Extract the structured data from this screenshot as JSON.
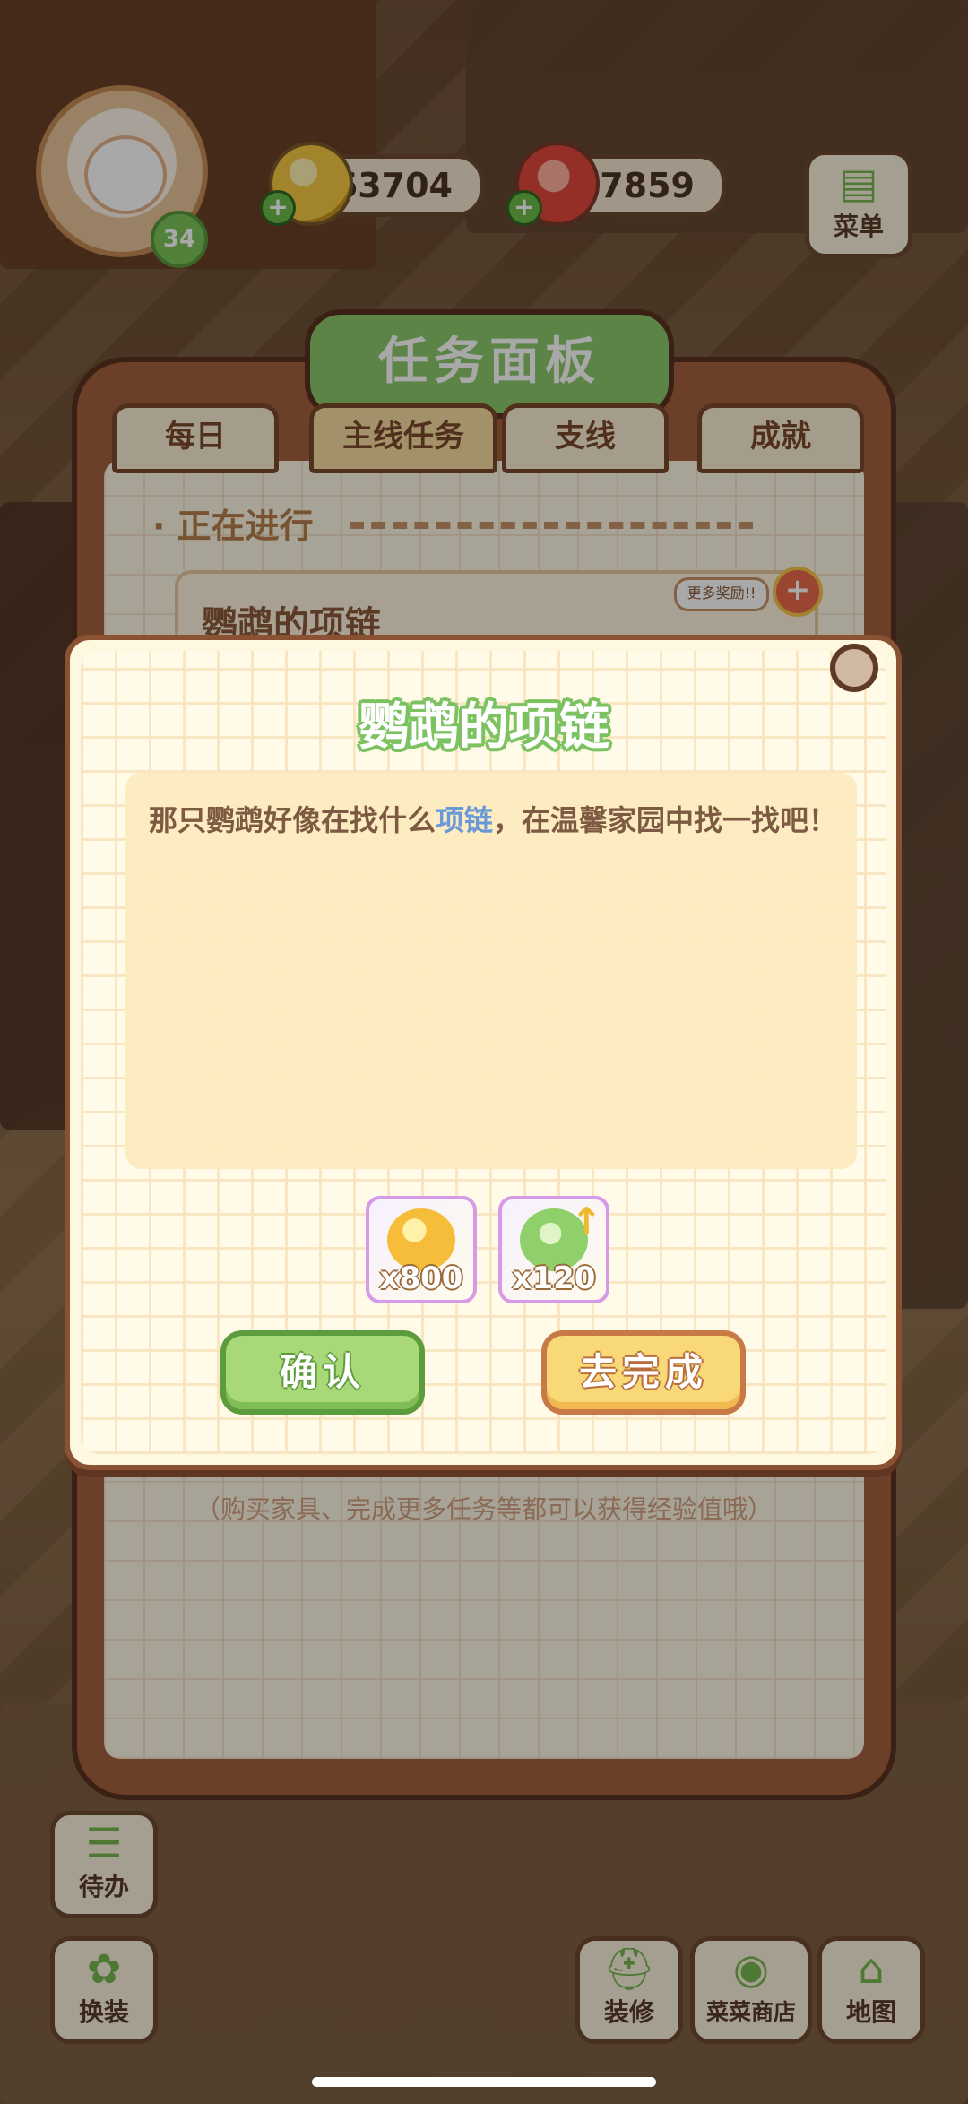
{
  "hud": {
    "level": "34",
    "coins": "163704",
    "gems": "7859",
    "menu_label": "菜单",
    "todo_label": "待办",
    "dress_label": "换装",
    "decorate_label": "装修",
    "shop_label": "菜菜商店",
    "map_label": "地图"
  },
  "task_panel": {
    "title": "任务面板",
    "tabs": [
      {
        "label": "每日"
      },
      {
        "label": "主线任务"
      },
      {
        "label": "支线"
      },
      {
        "label": "成就"
      }
    ],
    "section_label": "· 正在进行",
    "quest_title": "鹦鹉的项链",
    "more_reward": "更多奖励!!",
    "hint": "（购买家具、完成更多任务等都可以获得经验值哦）"
  },
  "dialog": {
    "title": "鹦鹉的项链",
    "desc_before": "那只鹦鹉好像在找什么",
    "desc_highlight": "项链",
    "desc_after": "，在温馨家园中找一找吧！",
    "rewards": [
      {
        "icon": "gold-coin-pile-icon",
        "qty": "x800"
      },
      {
        "icon": "green-exp-up-icon",
        "qty": "x120"
      }
    ],
    "confirm_label": "确认",
    "goto_label": "去完成"
  }
}
